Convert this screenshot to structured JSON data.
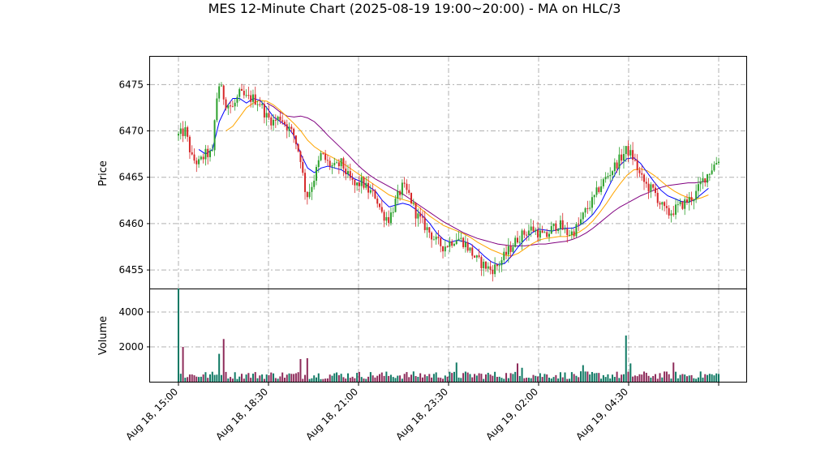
{
  "chart_data": {
    "type": "candlestick",
    "title": "MES 12-Minute Chart (2025-08-19 19:00~20:00) - MA on HLC/3",
    "price_panel": {
      "ylabel": "Price",
      "yticks": [
        6455,
        6460,
        6465,
        6470,
        6475
      ],
      "ylim": [
        6453,
        6478
      ],
      "grid": true,
      "moving_averages": [
        {
          "color": "#0000ff",
          "period": "short"
        },
        {
          "color": "#ffa500",
          "period": "medium"
        },
        {
          "color": "#800080",
          "period": "long"
        }
      ]
    },
    "volume_panel": {
      "ylabel": "Volume",
      "yticks": [
        2000,
        4000
      ],
      "ylim": [
        0,
        5300
      ],
      "grid": true
    },
    "x_axis": {
      "tick_labels": [
        "Aug 18, 15:00",
        "Aug 18, 18:30",
        "Aug 18, 21:00",
        "Aug 18, 23:30",
        "Aug 19, 02:00",
        "Aug 19, 04:30"
      ],
      "bar_count": 146
    },
    "colors": {
      "up": "#2ca02c",
      "down": "#d62728",
      "volume_up": "#117a65",
      "volume_down": "#8e2b5a"
    },
    "price_path": [
      [
        0,
        6469.5
      ],
      [
        2,
        6470
      ],
      [
        4,
        6467
      ],
      [
        6,
        6466.5
      ],
      [
        8,
        6467.5
      ],
      [
        10,
        6467.5
      ],
      [
        11,
        6473
      ],
      [
        12,
        6475
      ],
      [
        14,
        6473
      ],
      [
        16,
        6472.5
      ],
      [
        18,
        6474
      ],
      [
        20,
        6473.5
      ],
      [
        22,
        6473.5
      ],
      [
        24,
        6473
      ],
      [
        26,
        6471.5
      ],
      [
        28,
        6471
      ],
      [
        30,
        6471.5
      ],
      [
        32,
        6470.5
      ],
      [
        34,
        6469.5
      ],
      [
        36,
        6467
      ],
      [
        37,
        6464
      ],
      [
        38,
        6463
      ],
      [
        40,
        6465
      ],
      [
        42,
        6467.5
      ],
      [
        44,
        6466.5
      ],
      [
        46,
        6466
      ],
      [
        48,
        6466.5
      ],
      [
        50,
        6465
      ],
      [
        52,
        6464
      ],
      [
        54,
        6464.5
      ],
      [
        56,
        6463.5
      ],
      [
        58,
        6463
      ],
      [
        60,
        6461
      ],
      [
        62,
        6460.5
      ],
      [
        64,
        6462.5
      ],
      [
        66,
        6464
      ],
      [
        68,
        6463
      ],
      [
        70,
        6461
      ],
      [
        72,
        6460
      ],
      [
        74,
        6459
      ],
      [
        76,
        6458
      ],
      [
        78,
        6457.5
      ],
      [
        80,
        6458
      ],
      [
        82,
        6458.5
      ],
      [
        84,
        6458
      ],
      [
        86,
        6457
      ],
      [
        88,
        6456
      ],
      [
        90,
        6455.5
      ],
      [
        92,
        6455
      ],
      [
        94,
        6455.5
      ],
      [
        96,
        6456.5
      ],
      [
        98,
        6457.5
      ],
      [
        100,
        6458.5
      ],
      [
        102,
        6459
      ],
      [
        104,
        6459.5
      ],
      [
        106,
        6459
      ],
      [
        108,
        6458.5
      ],
      [
        110,
        6459.5
      ],
      [
        112,
        6460
      ],
      [
        114,
        6459
      ],
      [
        116,
        6459
      ],
      [
        118,
        6460
      ],
      [
        120,
        6461.5
      ],
      [
        122,
        6462.5
      ],
      [
        124,
        6464
      ],
      [
        126,
        6465
      ],
      [
        128,
        6466
      ],
      [
        130,
        6467
      ],
      [
        132,
        6468
      ],
      [
        134,
        6467
      ],
      [
        136,
        6465
      ],
      [
        138,
        6464
      ],
      [
        140,
        6463.5
      ],
      [
        142,
        6462
      ],
      [
        144,
        6461
      ],
      [
        146,
        6461.5
      ],
      [
        148,
        6462
      ],
      [
        150,
        6462.5
      ],
      [
        152,
        6463
      ],
      [
        154,
        6464.5
      ],
      [
        156,
        6465.5
      ],
      [
        158,
        6466.5
      ],
      [
        159,
        6467
      ]
    ],
    "ma_paths": {
      "blue": [
        [
          6,
          6468
        ],
        [
          8,
          6467.5
        ],
        [
          10,
          6468
        ],
        [
          12,
          6471
        ],
        [
          14,
          6472.5
        ],
        [
          16,
          6473.5
        ],
        [
          18,
          6473.5
        ],
        [
          20,
          6473
        ],
        [
          22,
          6473.5
        ],
        [
          24,
          6473.3
        ],
        [
          26,
          6472.5
        ],
        [
          28,
          6471.5
        ],
        [
          30,
          6471
        ],
        [
          32,
          6470.5
        ],
        [
          34,
          6469.5
        ],
        [
          36,
          6467.5
        ],
        [
          38,
          6466
        ],
        [
          40,
          6465.5
        ],
        [
          42,
          6466
        ],
        [
          44,
          6466.2
        ],
        [
          46,
          6466
        ],
        [
          48,
          6465.8
        ],
        [
          50,
          6465.3
        ],
        [
          52,
          6464.8
        ],
        [
          54,
          6464.5
        ],
        [
          56,
          6464
        ],
        [
          58,
          6463.5
        ],
        [
          60,
          6462.5
        ],
        [
          62,
          6461.8
        ],
        [
          64,
          6462
        ],
        [
          66,
          6462.2
        ],
        [
          68,
          6462
        ],
        [
          70,
          6461.5
        ],
        [
          72,
          6460.8
        ],
        [
          74,
          6460
        ],
        [
          76,
          6459
        ],
        [
          78,
          6458.3
        ],
        [
          80,
          6458
        ],
        [
          82,
          6458.2
        ],
        [
          84,
          6458.1
        ],
        [
          86,
          6457.8
        ],
        [
          88,
          6457.2
        ],
        [
          90,
          6456.5
        ],
        [
          92,
          6455.9
        ],
        [
          94,
          6455.6
        ],
        [
          96,
          6455.7
        ],
        [
          98,
          6456.5
        ],
        [
          100,
          6457.5
        ],
        [
          102,
          6458.3
        ],
        [
          104,
          6459
        ],
        [
          106,
          6459.4
        ],
        [
          108,
          6459.3
        ],
        [
          110,
          6459.2
        ],
        [
          112,
          6459.4
        ],
        [
          114,
          6459.5
        ],
        [
          116,
          6459.5
        ],
        [
          118,
          6459.8
        ],
        [
          120,
          6460.3
        ],
        [
          122,
          6461
        ],
        [
          124,
          6462
        ],
        [
          126,
          6463.5
        ],
        [
          128,
          6465
        ],
        [
          130,
          6466.3
        ],
        [
          132,
          6467
        ],
        [
          134,
          6467.1
        ],
        [
          136,
          6466.5
        ],
        [
          138,
          6465.5
        ],
        [
          140,
          6464.5
        ],
        [
          142,
          6463.6
        ],
        [
          144,
          6463
        ],
        [
          146,
          6462.7
        ],
        [
          148,
          6462.4
        ],
        [
          150,
          6462.3
        ],
        [
          152,
          6462.6
        ],
        [
          154,
          6463.2
        ],
        [
          156,
          6463.8
        ]
      ],
      "orange": [
        [
          14,
          6470
        ],
        [
          16,
          6470.5
        ],
        [
          18,
          6471.5
        ],
        [
          20,
          6472.5
        ],
        [
          22,
          6473
        ],
        [
          24,
          6473.3
        ],
        [
          26,
          6473.2
        ],
        [
          28,
          6472.8
        ],
        [
          30,
          6472.2
        ],
        [
          32,
          6471.5
        ],
        [
          34,
          6470.8
        ],
        [
          36,
          6470
        ],
        [
          38,
          6469
        ],
        [
          40,
          6468.3
        ],
        [
          42,
          6467.8
        ],
        [
          44,
          6467.4
        ],
        [
          46,
          6467
        ],
        [
          48,
          6466.6
        ],
        [
          50,
          6466.1
        ],
        [
          52,
          6465.6
        ],
        [
          54,
          6465.1
        ],
        [
          56,
          6464.6
        ],
        [
          58,
          6464.1
        ],
        [
          60,
          6463.6
        ],
        [
          62,
          6463.1
        ],
        [
          64,
          6462.8
        ],
        [
          66,
          6462.6
        ],
        [
          68,
          6462.4
        ],
        [
          70,
          6462
        ],
        [
          72,
          6461.4
        ],
        [
          74,
          6460.8
        ],
        [
          76,
          6460.3
        ],
        [
          78,
          6459.8
        ],
        [
          80,
          6459.5
        ],
        [
          82,
          6459.2
        ],
        [
          84,
          6458.9
        ],
        [
          86,
          6458.5
        ],
        [
          88,
          6458
        ],
        [
          90,
          6457.6
        ],
        [
          92,
          6457.2
        ],
        [
          94,
          6456.9
        ],
        [
          96,
          6456.6
        ],
        [
          98,
          6456.5
        ],
        [
          100,
          6456.8
        ],
        [
          102,
          6457.3
        ],
        [
          104,
          6457.8
        ],
        [
          106,
          6458.2
        ],
        [
          108,
          6458.4
        ],
        [
          110,
          6458.5
        ],
        [
          112,
          6458.6
        ],
        [
          114,
          6458.6
        ],
        [
          116,
          6458.8
        ],
        [
          118,
          6459.1
        ],
        [
          120,
          6459.6
        ],
        [
          122,
          6460.3
        ],
        [
          124,
          6461.2
        ],
        [
          126,
          6462.2
        ],
        [
          128,
          6463.3
        ],
        [
          130,
          6464.3
        ],
        [
          132,
          6465.2
        ],
        [
          134,
          6465.8
        ],
        [
          136,
          6465.9
        ],
        [
          138,
          6465.7
        ],
        [
          140,
          6465.2
        ],
        [
          142,
          6464.6
        ],
        [
          144,
          6464
        ],
        [
          146,
          6463.5
        ],
        [
          148,
          6463.1
        ],
        [
          150,
          6462.8
        ],
        [
          152,
          6462.6
        ],
        [
          154,
          6462.8
        ],
        [
          156,
          6463.1
        ]
      ],
      "purple": [
        [
          26,
          6473
        ],
        [
          28,
          6472.6
        ],
        [
          30,
          6472
        ],
        [
          32,
          6471.6
        ],
        [
          34,
          6471.5
        ],
        [
          36,
          6471.6
        ],
        [
          38,
          6471.4
        ],
        [
          40,
          6471
        ],
        [
          42,
          6470.3
        ],
        [
          44,
          6469.5
        ],
        [
          46,
          6468.8
        ],
        [
          48,
          6468.1
        ],
        [
          50,
          6467.4
        ],
        [
          52,
          6466.6
        ],
        [
          54,
          6465.9
        ],
        [
          56,
          6465.3
        ],
        [
          58,
          6464.8
        ],
        [
          60,
          6464.4
        ],
        [
          62,
          6464
        ],
        [
          64,
          6463.6
        ],
        [
          66,
          6463.2
        ],
        [
          68,
          6462.7
        ],
        [
          70,
          6462.2
        ],
        [
          72,
          6461.7
        ],
        [
          74,
          6461.2
        ],
        [
          76,
          6460.7
        ],
        [
          78,
          6460.2
        ],
        [
          80,
          6459.8
        ],
        [
          82,
          6459.4
        ],
        [
          84,
          6459
        ],
        [
          86,
          6458.7
        ],
        [
          88,
          6458.4
        ],
        [
          90,
          6458.2
        ],
        [
          92,
          6458
        ],
        [
          94,
          6457.8
        ],
        [
          96,
          6457.7
        ],
        [
          98,
          6457.6
        ],
        [
          100,
          6457.6
        ],
        [
          102,
          6457.6
        ],
        [
          104,
          6457.7
        ],
        [
          106,
          6457.8
        ],
        [
          108,
          6457.8
        ],
        [
          110,
          6457.9
        ],
        [
          112,
          6458
        ],
        [
          114,
          6458.1
        ],
        [
          116,
          6458.3
        ],
        [
          118,
          6458.6
        ],
        [
          120,
          6459
        ],
        [
          122,
          6459.5
        ],
        [
          124,
          6460.1
        ],
        [
          126,
          6460.7
        ],
        [
          128,
          6461.3
        ],
        [
          130,
          6461.8
        ],
        [
          132,
          6462.2
        ],
        [
          134,
          6462.6
        ],
        [
          136,
          6463
        ],
        [
          138,
          6463.3
        ],
        [
          140,
          6463.6
        ],
        [
          142,
          6463.9
        ],
        [
          144,
          6464.1
        ],
        [
          146,
          6464.2
        ],
        [
          148,
          6464.3
        ],
        [
          150,
          6464.4
        ],
        [
          152,
          6464.4
        ],
        [
          154,
          6464.5
        ],
        [
          156,
          6464.6
        ]
      ]
    },
    "volume_spikes": [
      [
        0,
        5350
      ],
      [
        1,
        2000
      ],
      [
        12,
        1600
      ],
      [
        13,
        2450
      ],
      [
        36,
        1300
      ],
      [
        38,
        1350
      ],
      [
        82,
        1100
      ],
      [
        100,
        1050
      ],
      [
        101,
        800
      ],
      [
        119,
        950
      ],
      [
        132,
        2650
      ],
      [
        133,
        1050
      ],
      [
        146,
        1100
      ]
    ]
  }
}
